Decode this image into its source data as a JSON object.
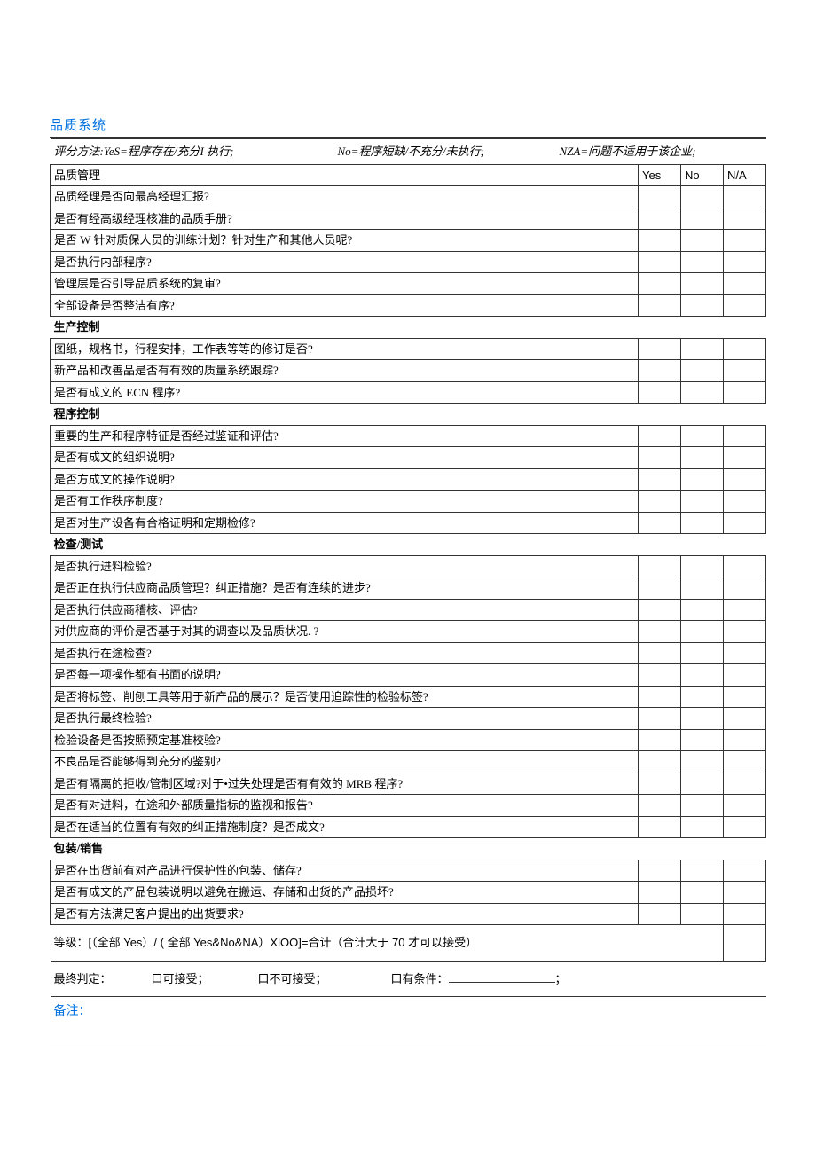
{
  "title": "品质系统",
  "scoring": {
    "label": "评分方法:",
    "yes": "YeS=程序存在/充分I 执行;",
    "no": "No=程序短缺/不充分/未执行;",
    "na": "NZA=问题不适用于该企业;"
  },
  "cols": {
    "yes": "Yes",
    "no": "No",
    "na": "N/A"
  },
  "sections": [
    {
      "name": "品质管理",
      "as_header_row": true,
      "items": [
        "品质经理是否向最高经理汇报?",
        "是否有经高级经理核准的品质手册?",
        "是否 W 针对质保人员的训练计划？针对生产和其他人员呢?",
        "是否执行内部程序?",
        "管理层是否引导品质系统的复审?",
        "全部设备是否整洁有序?"
      ]
    },
    {
      "name": "生产控制",
      "items": [
        "图纸，规格书，行程安排，工作表等等的修订是否?",
        "新产品和改善品是否有有效的质量系统跟踪?",
        "是否有成文的 ECN 程序?"
      ]
    },
    {
      "name": "程序控制",
      "items": [
        "重要的生产和程序特征是否经过鉴证和评估?",
        "是否有成文的组织说明?",
        "是否方成文的操作说明?",
        "是否有工作秩序制度?",
        "是否对生产设备有合格证明和定期检修?"
      ]
    },
    {
      "name": "检查/测试",
      "items": [
        "是否执行进料检验?",
        "是否正在执行供应商品质管理？纠正措施？是否有连续的进步?",
        "是否执行供应商稽核、评估?",
        "对供应商的评价是否基于对其的调查以及品质状况. ?",
        "是否执行在途检查?",
        "是否每一项操作都有书面的说明?",
        "是否将标签、削刨工具等用于新产品的展示？是否使用追踪性的检验标签?",
        "是否执行最终检验?",
        "检验设备是否按照预定基准校验?",
        "不良品是否能够得到充分的鉴别?",
        "是否有隔离的拒收/管制区域?对于•过失处理是否有有效的 MRB 程序?",
        "是否有对进料，在途和外部质量指标的监视和报告?",
        "是否在适当的位置有有效的纠正措施制度？是否成文?"
      ]
    },
    {
      "name": "包装/销售",
      "items": [
        "是否在出货前有对产品进行保护性的包装、储存?",
        "是否有成文的产品包装说明以避免在搬运、存储和出货的产品损坏?",
        "是否有方法满足客户提出的出货要求?"
      ]
    }
  ],
  "grade": "等级：[（全部 Yes）/ ( 全部 Yes&No&NA）XlOO]=合计（合计大于 70 才可以接受）",
  "judge": {
    "label": "最终判定：",
    "opt1": "口可接受；",
    "opt2": "口不可接受；",
    "opt3": "口有条件：",
    "tail": "；"
  },
  "remark": "备注："
}
